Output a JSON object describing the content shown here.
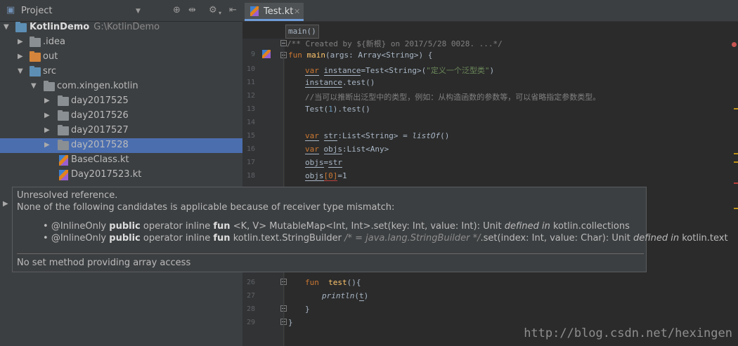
{
  "project": {
    "title": "Project",
    "tree": [
      {
        "label": "KotlinDemo",
        "path": "G:\\KotlinDemo"
      },
      {
        "label": ".idea"
      },
      {
        "label": "out"
      },
      {
        "label": "src"
      },
      {
        "label": "com.xingen.kotlin"
      },
      {
        "label": "day2017525"
      },
      {
        "label": "day2017526"
      },
      {
        "label": "day2017527"
      },
      {
        "label": "day2017528"
      },
      {
        "label": "BaseClass.kt"
      },
      {
        "label": "Day2017523.kt"
      }
    ]
  },
  "editor": {
    "tab": "Test.kt",
    "breadcrumb": "main()",
    "lines": {
      "n9": "9",
      "n10": "10",
      "n11": "11",
      "n12": "12",
      "n13": "13",
      "n14": "14",
      "n15": "15",
      "n16": "16",
      "n17": "17",
      "n18": "18",
      "n26": "26",
      "n27": "27",
      "n28": "28",
      "n29": "29"
    },
    "code": {
      "l8": "/** Created by ${新根} on 2017/5/28 0028. ...*/",
      "l9_kw": "fun",
      "l9_fn": "main",
      "l9_rest": "(args: Array<String>) {",
      "l10_kw": "var",
      "l10_var": "instance",
      "l10_mid": "=Test<String>(",
      "l10_str": "\"定义一个泛型类\"",
      "l10_end": ")",
      "l11_var": "instance",
      "l11_rest": ".test()",
      "l12": "//当可以推断出泛型中的类型，例如：从构造函数的参数等，可以省略指定参数类型。",
      "l13_a": "Test(",
      "l13_num": "1",
      "l13_b": ").test()",
      "l15_kw": "var",
      "l15_var": "str",
      "l15_mid": ":List<String> = ",
      "l15_fn": "listOf",
      "l15_end": "()",
      "l16_kw": "var",
      "l16_var": "objs",
      "l16_rest": ":List<Any>",
      "l17_a": "objs",
      "l17_b": "=",
      "l17_c": "str",
      "l18_a": "objs",
      "l18_b": "[0]",
      "l18_c": "=1",
      "l26_kw": "fun",
      "l26_fn": "test",
      "l26_rest": "(){",
      "l27_fn": "println",
      "l27_a": "(",
      "l27_b": "t",
      "l27_c": ")",
      "l28": "}",
      "l29": "}"
    }
  },
  "tooltip": {
    "title": "Unresolved reference.",
    "subtitle": "None of the following candidates is applicable because of receiver type mismatch:",
    "c1": {
      "ann": "@InlineOnly",
      "pub": "public",
      "mods": "operator inline",
      "fun": "fun",
      "sig": "<K, V> MutableMap<Int, Int>.set(key: Int, value: Int): Unit",
      "def": "defined in",
      "pkg": "kotlin.collections"
    },
    "c2": {
      "ann": "@InlineOnly",
      "pub": "public",
      "mods": "operator inline",
      "fun": "fun",
      "sig1": "kotlin.text.StringBuilder",
      "cmt": "/* = java.lang.StringBuilder */",
      "sig2": ".set(index: Int, value: Char): Unit",
      "def": "defined in",
      "pkg": "kotlin.text"
    },
    "footer": "No set method providing array access"
  },
  "watermark": "http://blog.csdn.net/hexingen"
}
